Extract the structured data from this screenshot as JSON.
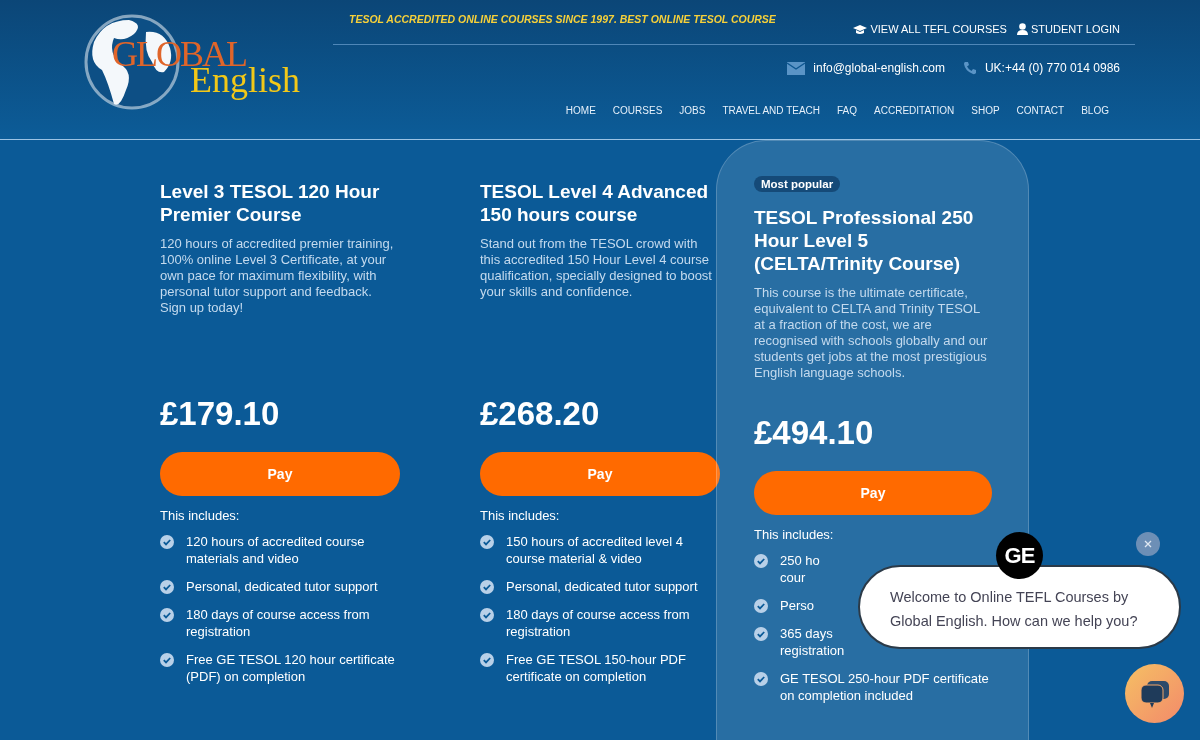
{
  "logo": {
    "word_1": "GLOBAL",
    "word_2": "English"
  },
  "tagline": "TESOL ACCREDITED ONLINE COURSES SINCE 1997. BEST ONLINE TESOL COURSE",
  "top_links": [
    {
      "kind": "courses",
      "label": "VIEW ALL TEFL COURSES"
    },
    {
      "kind": "login",
      "label": "STUDENT LOGIN"
    }
  ],
  "contact": {
    "email": "info@global-english.com",
    "phone": "UK:+44 (0) 770 014 0986"
  },
  "nav": [
    "HOME",
    "COURSES",
    "JOBS",
    "TRAVEL AND TEACH",
    "FAQ",
    "ACCREDITATION",
    "SHOP",
    "CONTACT",
    "BLOG"
  ],
  "courses": [
    {
      "featured": false,
      "title": "Level 3 TESOL 120 Hour Premier Course",
      "description": "120 hours of accredited premier training, 100% online Level 3 Certificate, at your own pace for maximum flexibility, with personal tutor support and feedback. Sign up today!",
      "price": "£179.10",
      "button": "Pay",
      "includes_label": "This includes:",
      "features": [
        [
          "120 hours of accredited course materials and video"
        ],
        [
          "Personal, dedicated tutor support"
        ],
        [
          "180 days of course access from registration"
        ],
        [
          "Free GE TESOL 120 hour certificate (PDF) on completion"
        ]
      ]
    },
    {
      "featured": false,
      "title": "TESOL Level 4 Advanced 150 hours course",
      "description": "Stand out from the TESOL crowd with this accredited 150 Hour Level 4 course qualification, specially designed to boost your skills and confidence.",
      "price": "£268.20",
      "button": "Pay",
      "includes_label": "This includes:",
      "features": [
        [
          "150 hours of accredited level 4 course material & video"
        ],
        [
          "Personal, dedicated tutor support"
        ],
        [
          "180 days of course access from registration"
        ],
        [
          "Free GE TESOL 150-hour PDF certificate on completion"
        ]
      ]
    },
    {
      "featured": true,
      "badge": "Most popular",
      "title": "TESOL Professional 250 Hour Level 5 (CELTA/Trinity Course)",
      "description": "This course is the ultimate certificate, equivalent to CELTA and Trinity TESOL at a fraction of the cost, we are recognised with schools globally and our students get jobs at the most prestigious English language schools.",
      "price": "£494.10",
      "button": "Pay",
      "includes_label": "This includes:",
      "features": [
        [
          "250 ho",
          "cour"
        ],
        [
          "Perso"
        ],
        [
          "365 days",
          "registration"
        ],
        [
          "GE TESOL 250-hour PDF certificate on completion included"
        ]
      ]
    }
  ],
  "chat": {
    "avatar": "GE",
    "message": "Welcome to Online TEFL Courses by Global English. How can we help you?"
  }
}
